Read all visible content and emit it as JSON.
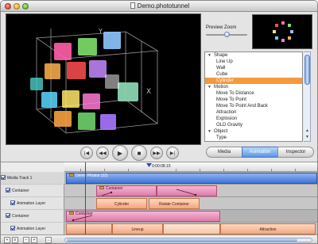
{
  "window": {
    "title": "Demo.phototunnel"
  },
  "preview": {
    "zoom_label": "Preview Zoom",
    "zoom_value": 0.5
  },
  "tree": {
    "items": [
      {
        "label": "Shape",
        "kind": "group"
      },
      {
        "label": "Line Up",
        "kind": "item"
      },
      {
        "label": "Wall",
        "kind": "item"
      },
      {
        "label": "Cube",
        "kind": "item"
      },
      {
        "label": "Cylinder",
        "kind": "item",
        "selected": true
      },
      {
        "label": "Motion",
        "kind": "group"
      },
      {
        "label": "Move To Distance",
        "kind": "item"
      },
      {
        "label": "Move To Point",
        "kind": "item"
      },
      {
        "label": "Move To Point And Back",
        "kind": "item"
      },
      {
        "label": "Attraction",
        "kind": "item"
      },
      {
        "label": "Explosion",
        "kind": "item"
      },
      {
        "label": "OLD Gravity",
        "kind": "item"
      },
      {
        "label": "Object",
        "kind": "group"
      },
      {
        "label": "Type",
        "kind": "item"
      },
      {
        "label": "Size",
        "kind": "item"
      }
    ],
    "selected_color": "#f39a3a"
  },
  "tabs": [
    {
      "label": "Media",
      "active": false
    },
    {
      "label": "Animation",
      "active": true
    },
    {
      "label": "Inspector",
      "active": false
    }
  ],
  "transport": {
    "rewind": "rewind-start-icon",
    "prev": "step-back-icon",
    "play": "play-icon",
    "stop": "stop-icon",
    "next": "fast-forward-icon",
    "end": "skip-end-icon"
  },
  "timeline": {
    "timecode": "0:00:08.15",
    "tracks": [
      {
        "label": "Media Track 1"
      },
      {
        "label": "Container"
      },
      {
        "label": "Animation Layer"
      },
      {
        "label": "Container"
      },
      {
        "label": "Animation Layer"
      }
    ],
    "blocks": {
      "main": "Demo Photos (32)",
      "container1": "Container",
      "container2": "Container",
      "anim1": "Cylinder",
      "anim2": "Rotate Container",
      "anim3": "Lineup",
      "anim4": "Attraction"
    }
  },
  "colors": {
    "accent_blue": "#3f74d6",
    "container_pink": "#e07aa9",
    "animation_peach": "#f2a77f"
  }
}
